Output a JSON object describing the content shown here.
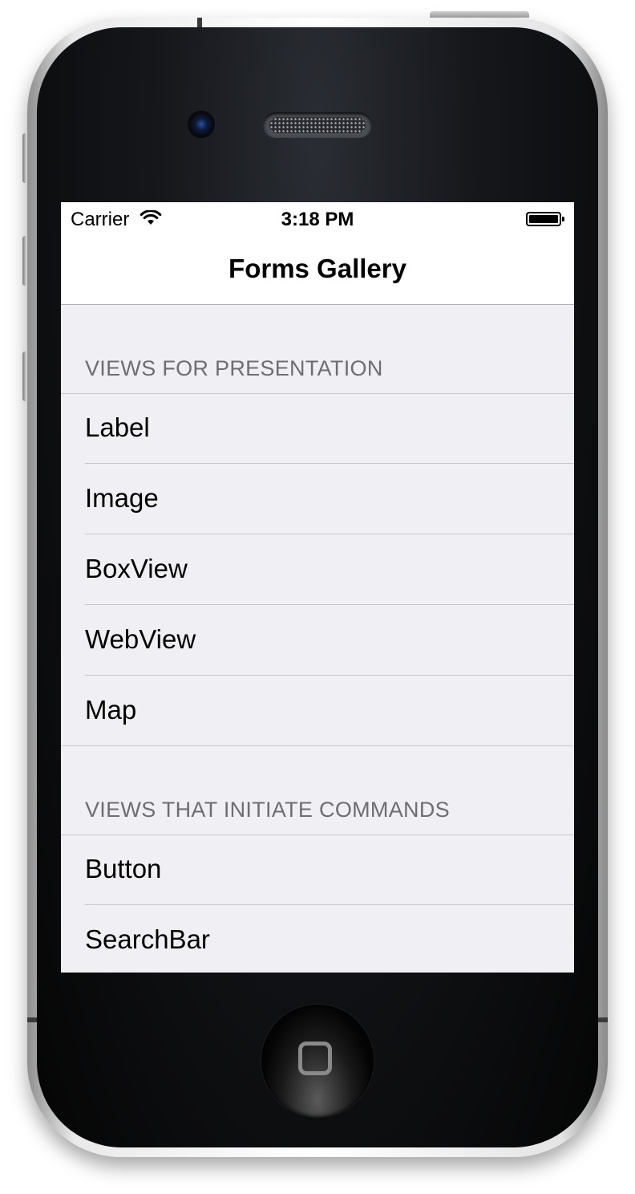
{
  "status_bar": {
    "carrier": "Carrier",
    "time": "3:18 PM",
    "wifi_icon": "wifi-icon",
    "battery_icon": "battery-icon"
  },
  "navigation": {
    "title": "Forms Gallery"
  },
  "sections": [
    {
      "header": "VIEWS FOR PRESENTATION",
      "items": [
        "Label",
        "Image",
        "BoxView",
        "WebView",
        "Map"
      ]
    },
    {
      "header": "VIEWS THAT INITIATE COMMANDS",
      "items": [
        "Button",
        "SearchBar"
      ]
    }
  ],
  "device": {
    "home_button_icon": "home-button-icon",
    "colors": {
      "screen_background": "#efeff4",
      "header_text": "#6d6d72",
      "separator": "#c8c7cc"
    }
  }
}
